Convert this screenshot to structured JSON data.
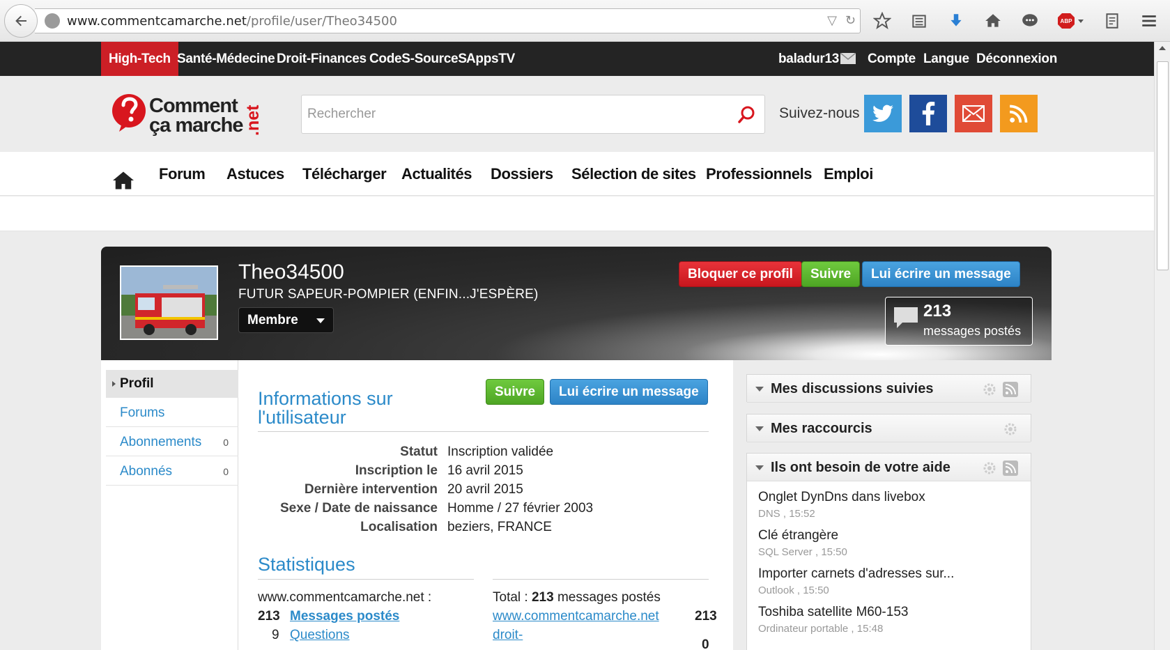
{
  "browser": {
    "url_host": "www.commentcamarche.net",
    "url_path": "/profile/user/Theo34500"
  },
  "topnav": {
    "sections": [
      "High-Tech",
      "Santé-Médecine",
      "Droit-Finances",
      "CodeS-SourceS",
      "AppsTV"
    ],
    "username": "baladur13",
    "account": "Compte",
    "language": "Langue",
    "logout": "Déconnexion"
  },
  "header": {
    "logo_line1": "Comment",
    "logo_line2": "ça marche",
    "logo_suffix": ".net",
    "search_placeholder": "Rechercher",
    "follow_label": "Suivez-nous",
    "social": [
      "twitter-icon",
      "facebook-icon",
      "email-icon",
      "rss-icon"
    ],
    "social_colors": [
      "#3b9ad9",
      "#1e4c9a",
      "#e04a36",
      "#f39a1e"
    ]
  },
  "mainnav": [
    "Forum",
    "Astuces",
    "Télécharger",
    "Actualités",
    "Dossiers",
    "Sélection de sites",
    "Professionnels",
    "Emploi"
  ],
  "profile": {
    "name": "Theo34500",
    "tagline": "FUTUR SAPEUR-POMPIER (ENFIN...J'ESPÈRE)",
    "role": "Membre",
    "block_label": "Bloquer ce profil",
    "follow_label": "Suivre",
    "message_label": "Lui écrire un message",
    "messages_count": "213",
    "messages_label": "messages postés"
  },
  "sidebar": {
    "items": [
      {
        "label": "Profil",
        "count": ""
      },
      {
        "label": "Forums",
        "count": ""
      },
      {
        "label": "Abonnements",
        "count": "0"
      },
      {
        "label": "Abonnés",
        "count": "0"
      }
    ]
  },
  "info": {
    "title": "Informations sur l'utilisateur",
    "follow_label": "Suivre",
    "message_label": "Lui écrire un message",
    "rows": [
      {
        "key": "Statut",
        "value": "Inscription validée"
      },
      {
        "key": "Inscription le",
        "value": "16 avril 2015"
      },
      {
        "key": "Dernière intervention",
        "value": "20 avril 2015"
      },
      {
        "key": "Sexe / Date de naissance",
        "value": "Homme / 27 février 2003"
      },
      {
        "key": "Localisation",
        "value": "beziers, FRANCE"
      }
    ]
  },
  "stats": {
    "title": "Statistiques",
    "site_label": "www.commentcamarche.net :",
    "posts_num": "213",
    "posts_label": "Messages postés",
    "questions_num": "9",
    "questions_label": "Questions",
    "total_prefix": "Total : ",
    "total_num": "213",
    "total_suffix": " messages postés",
    "site_link": "www.commentcamarche.net",
    "site_count": "213",
    "droit_link": "droit-",
    "droit_count": "0"
  },
  "widgets": {
    "followed": "Mes discussions suivies",
    "shortcuts": "Mes raccourcis",
    "help": "Ils ont besoin de votre aide",
    "help_items": [
      {
        "title": "Onglet DynDns dans livebox",
        "category": "DNS",
        "time": "15:52"
      },
      {
        "title": "Clé étrangère",
        "category": "SQL Server",
        "time": "15:50"
      },
      {
        "title": "Importer carnets d'adresses sur...",
        "category": "Outlook",
        "time": "15:50"
      },
      {
        "title": "Toshiba satellite M60-153",
        "category": "Ordinateur portable",
        "time": "15:48"
      }
    ]
  }
}
